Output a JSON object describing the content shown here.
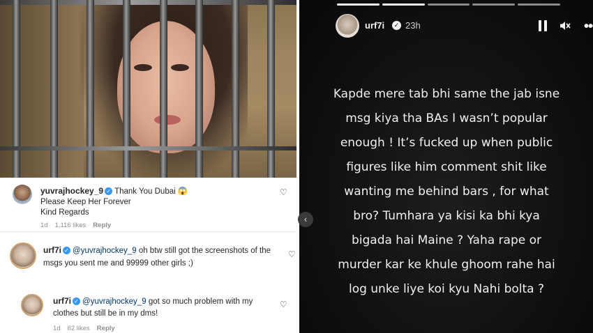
{
  "post_comments": {
    "comments": [
      {
        "username": "yuvrajhockey_9",
        "text_lines": [
          "Thank You Dubai 😱",
          "Please Keep Her Forever",
          "Kind Regards"
        ],
        "age": "1d",
        "likes": "1,116 likes",
        "reply_label": "Reply"
      },
      {
        "username": "urf7i",
        "mention": "@yuvrajhockey_9",
        "text": "oh btw still got the screenshots of the msgs you sent me and 99999 other girls ;)"
      },
      {
        "username": "urf7i",
        "mention": "@yuvrajhockey_9",
        "text": "got so much problem with my clothes but still be in my dms!",
        "age": "1d",
        "likes": "62 likes",
        "reply_label": "Reply"
      }
    ]
  },
  "story": {
    "username": "urf7i",
    "time": "23h",
    "progress": {
      "segments": 5,
      "completed": 2
    },
    "icons": [
      "pause-icon",
      "mute-icon",
      "more-icon"
    ],
    "text_lines": [
      "Kapde mere tab bhi same the jab isne",
      "msg kiya tha BAs I wasn’t popular",
      "enough ! It’s fucked up when public",
      "figures like him comment shit like",
      "wanting me behind bars , for what",
      "bro?  Tumhara ya kisi ka bhi kya",
      "bigada hai Maine ? Yaha rape or",
      "murder kar ke khule ghoom rahe hai",
      "log unke liye koi kyu Nahi bolta ?"
    ]
  },
  "colors": {
    "verified_badge": "#3897f0",
    "story_bg": "#111111",
    "mention": "#00376b"
  }
}
